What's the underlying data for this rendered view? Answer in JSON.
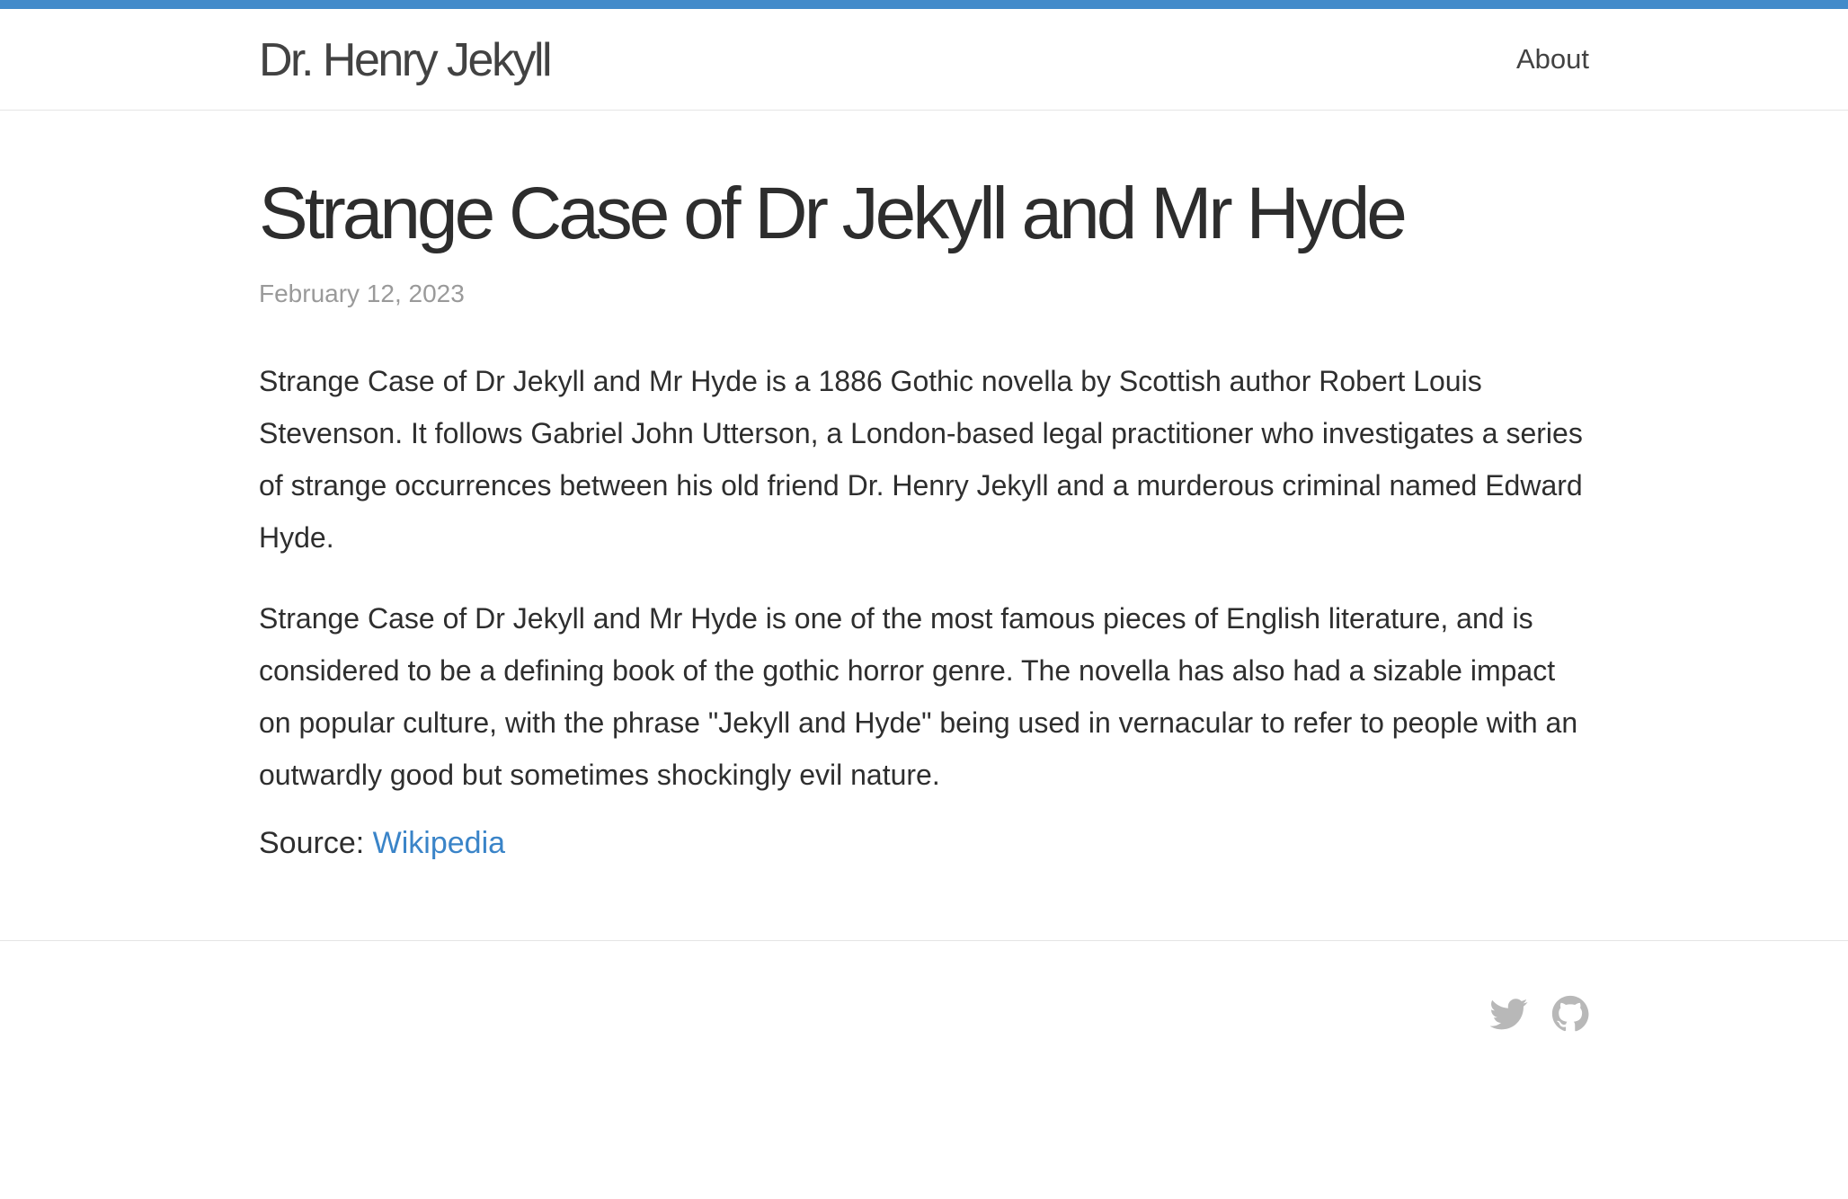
{
  "header": {
    "site_title": "Dr. Henry Jekyll",
    "nav": [
      {
        "label": "About"
      }
    ]
  },
  "post": {
    "title": "Strange Case of Dr Jekyll and Mr Hyde",
    "date": "February 12, 2023",
    "paragraphs": [
      "Strange Case of Dr Jekyll and Mr Hyde is a 1886 Gothic novella by Scottish author Robert Louis Stevenson. It follows Gabriel John Utterson, a London-based legal practitioner who investigates a series of strange occurrences between his old friend Dr. Henry Jekyll and a murderous criminal named Edward Hyde.",
      "Strange Case of Dr Jekyll and Mr Hyde is one of the most famous pieces of English literature, and is considered to be a defining book of the gothic horror genre. The novella has also had a sizable impact on popular culture, with the phrase \"Jekyll and Hyde\" being used in vernacular to refer to people with an outwardly good but sometimes shockingly evil nature."
    ],
    "source_prefix": "Source:",
    "source_link_label": "Wikipedia"
  },
  "footer": {
    "social_icons": [
      "twitter-icon",
      "github-icon"
    ]
  },
  "colors": {
    "accent_bar": "#428bca",
    "link": "#3a84c8",
    "muted": "#9a9a9a",
    "icon_gray": "#b8b8b8"
  }
}
